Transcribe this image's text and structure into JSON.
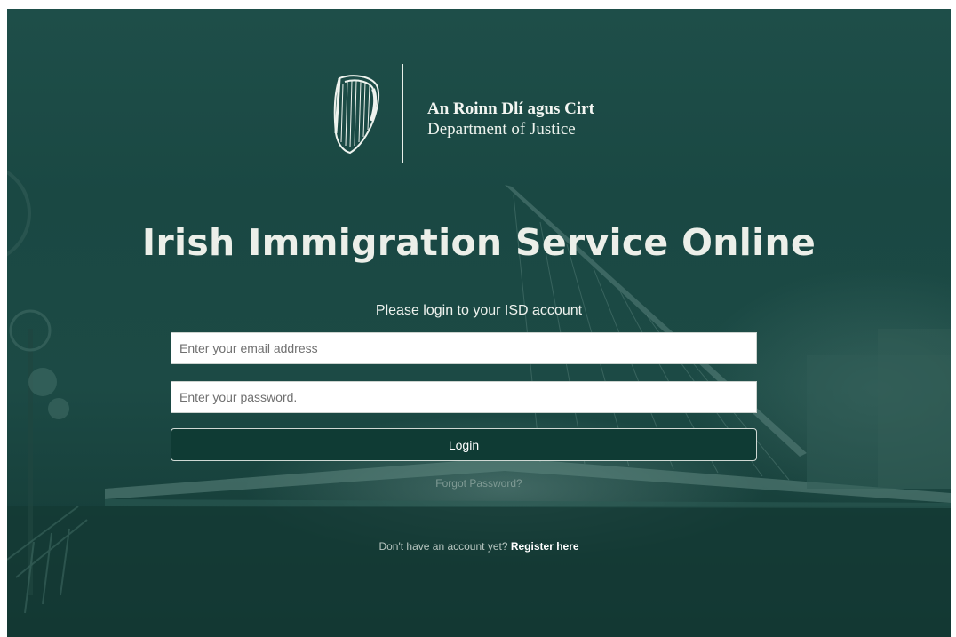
{
  "header": {
    "department_irish": "An Roinn Dlí agus Cirt",
    "department_english": "Department of Justice",
    "logo_icon": "harp-icon"
  },
  "main": {
    "title": "Irish Immigration Service Online",
    "login_prompt": "Please login to your ISD account",
    "email": {
      "value": "",
      "placeholder": "Enter your email address"
    },
    "password": {
      "value": "",
      "placeholder": "Enter your password."
    },
    "login_label": "Login",
    "forgot_password": "Forgot Password?",
    "register_prompt": "Don't have an account yet?",
    "register_link": "Register here"
  },
  "colors": {
    "overlay": "#1c4a45",
    "button": "#0f3b34",
    "title_text": "#ecefe9"
  }
}
